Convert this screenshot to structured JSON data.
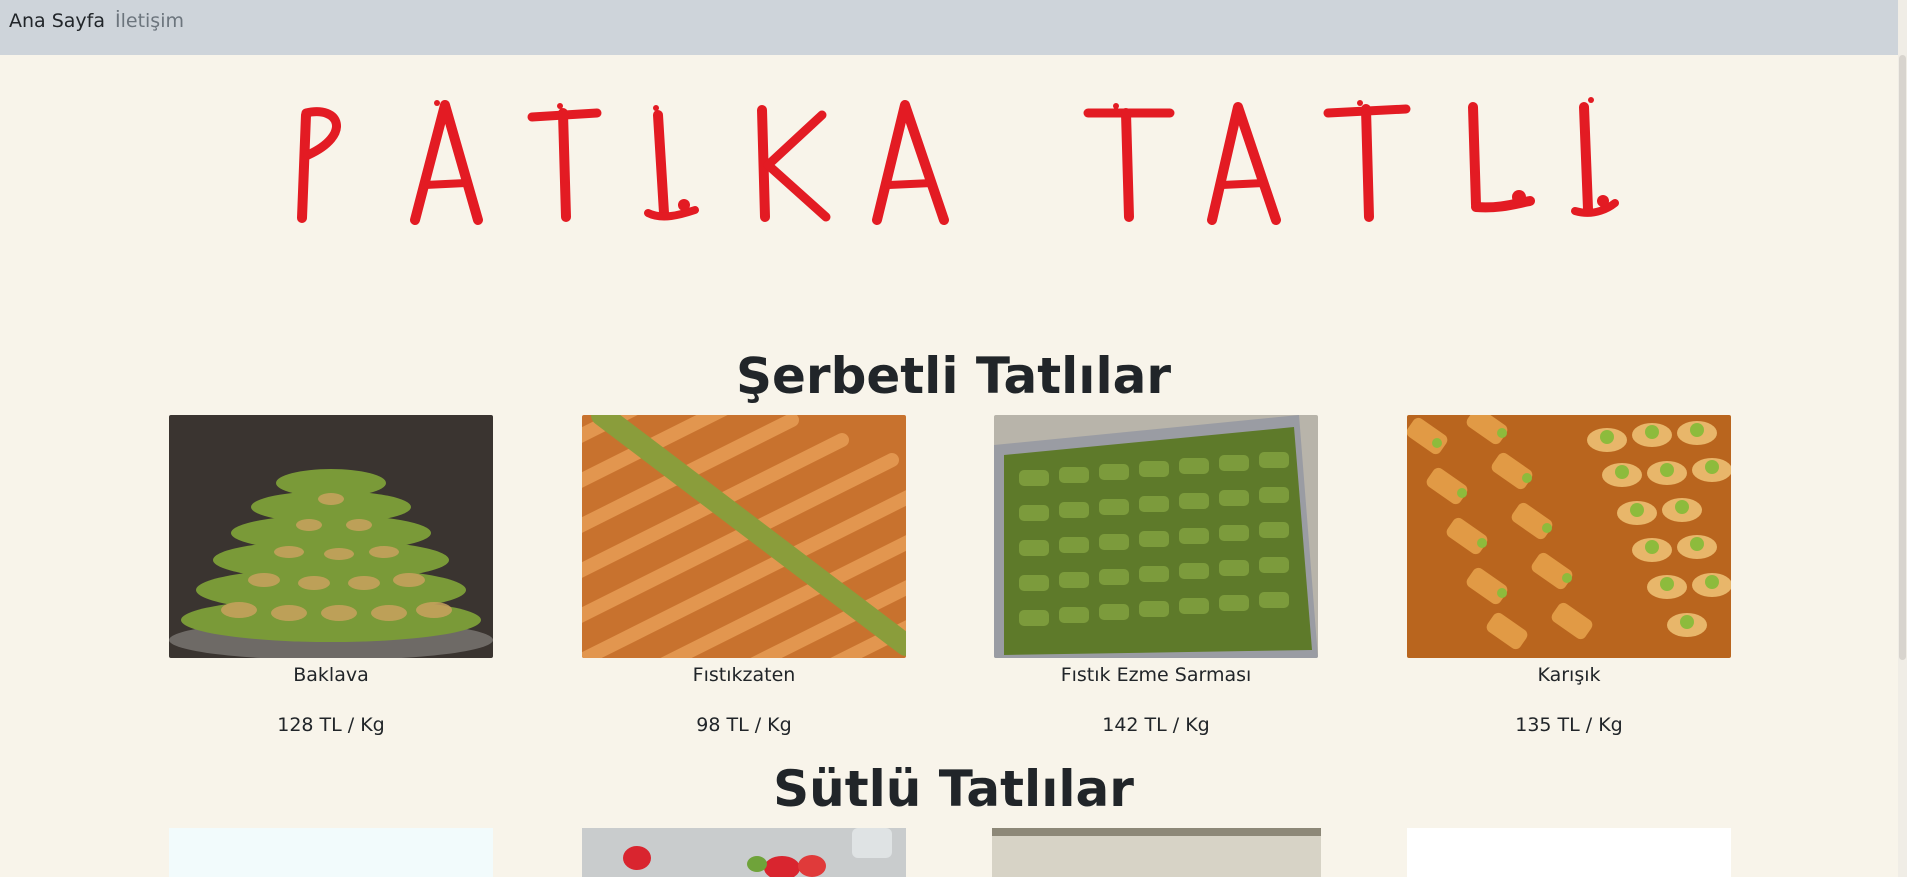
{
  "nav": {
    "home": "Ana Sayfa",
    "contact": "İletişim"
  },
  "logo": {
    "text": "PATIKA TATLI",
    "color": "#e31b23"
  },
  "sections": [
    {
      "title": "Şerbetli Tatlılar",
      "items": [
        {
          "name": "Baklava",
          "price": "128 TL / Kg",
          "image": "baklava-photo"
        },
        {
          "name": "Fıstıkzaten",
          "price": "98 TL / Kg",
          "image": "fistikzaten-photo"
        },
        {
          "name": "Fıstık Ezme Sarması",
          "price": "142 TL / Kg",
          "image": "fistik-ezme-sarmasi-photo"
        },
        {
          "name": "Karışık",
          "price": "135 TL / Kg",
          "image": "karisik-photo"
        }
      ]
    },
    {
      "title": "Sütlü Tatlılar"
    }
  ],
  "colors": {
    "navbar": "#ced4da",
    "page_background": "#f8f4ea",
    "text": "#212529",
    "muted_link": "#6c757d"
  }
}
